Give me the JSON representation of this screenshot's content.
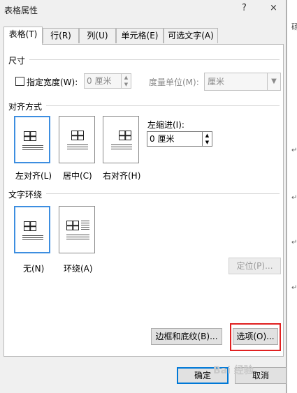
{
  "window": {
    "title": "表格属性",
    "help_btn": "?",
    "close_btn": "×"
  },
  "tabs": [
    {
      "label": "表格(T)"
    },
    {
      "label": "行(R)"
    },
    {
      "label": "列(U)"
    },
    {
      "label": "单元格(E)"
    },
    {
      "label": "可选文字(A)"
    }
  ],
  "size": {
    "title": "尺寸",
    "width_checkbox_label": "指定宽度(W):",
    "width_value": "0 厘米",
    "unit_label": "度量单位(M):",
    "unit_value": "厘米"
  },
  "alignment": {
    "title": "对齐方式",
    "left": "左对齐(L)",
    "center": "居中(C)",
    "right": "右对齐(H)",
    "indent_label": "左缩进(I):",
    "indent_value": "0 厘米"
  },
  "wrapping": {
    "title": "文字环绕",
    "none": "无(N)",
    "around": "环绕(A)",
    "position_btn": "定位(P)..."
  },
  "buttons": {
    "borders": "边框和底纹(B)...",
    "options": "选项(O)...",
    "ok": "确定",
    "cancel": "取消"
  },
  "background": {
    "fragment": "砀"
  },
  "watermark": "Bai 经验"
}
